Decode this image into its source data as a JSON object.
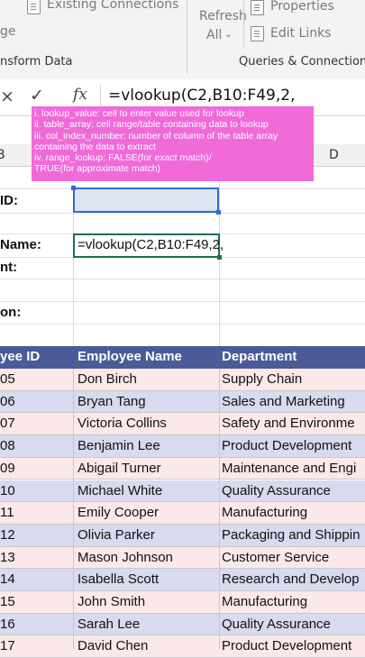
{
  "ribbon": {
    "existing_connections": "Existing Connections",
    "left_fragment": "ge",
    "refresh_label": "Refresh",
    "refresh_all_label": "All",
    "properties": "Properties",
    "edit_links": "Edit Links",
    "group_transform": "nsform Data",
    "group_queries": "Queries & Connections"
  },
  "formula_bar": {
    "cancel_icon": "×",
    "enter_icon": "✓",
    "fx_label": "fx",
    "formula": "=vlookup(C2,B10:F49,2,"
  },
  "tooltip": {
    "lines": [
      "i. lookup_value: cell to enter value used for lookup",
      "ii. table_array: cell range/table containing data to lookup",
      "iii. col_index_number: number of column of the table array",
      "containing the data to extract",
      "iv. range_lookup: FALSE(for exact match)/",
      "TRUE(for approximate match)"
    ]
  },
  "columns": {
    "b": "B",
    "d": "D"
  },
  "form": {
    "id_label": "ID:",
    "name_label": "Name:",
    "dept_label": "nt:",
    "position_label": "on:",
    "edit_value": "=vlookup(C2,B10:F49,2,"
  },
  "table": {
    "headers": [
      "yee ID",
      "Employee Name",
      "Department"
    ],
    "rows": [
      [
        "05",
        "Don Birch",
        "Supply Chain"
      ],
      [
        "06",
        "Bryan Tang",
        "Sales and Marketing"
      ],
      [
        "07",
        "Victoria Collins",
        "Safety and Environme"
      ],
      [
        "08",
        "Benjamin Lee",
        "Product Development"
      ],
      [
        "09",
        "Abigail Turner",
        "Maintenance and Engi"
      ],
      [
        "10",
        "Michael White",
        "Quality Assurance"
      ],
      [
        "11",
        "Emily Cooper",
        "Manufacturing"
      ],
      [
        "12",
        "Olivia Parker",
        "Packaging and Shippin"
      ],
      [
        "13",
        "Mason Johnson",
        "Customer Service"
      ],
      [
        "14",
        "Isabella Scott",
        "Research and Develop"
      ],
      [
        "15",
        "John Smith",
        "Manufacturing"
      ],
      [
        "16",
        "Sarah Lee",
        "Quality Assurance"
      ],
      [
        "17",
        "David Chen",
        "Product Development"
      ]
    ]
  },
  "colors": {
    "header_bg": "#4c5a97",
    "tooltip_bg": "#f06ad8",
    "row_odd": "#fbe8e8",
    "row_even": "#d9d9ef",
    "selection": "#2e6ec8",
    "edit_border": "#1e7145"
  }
}
